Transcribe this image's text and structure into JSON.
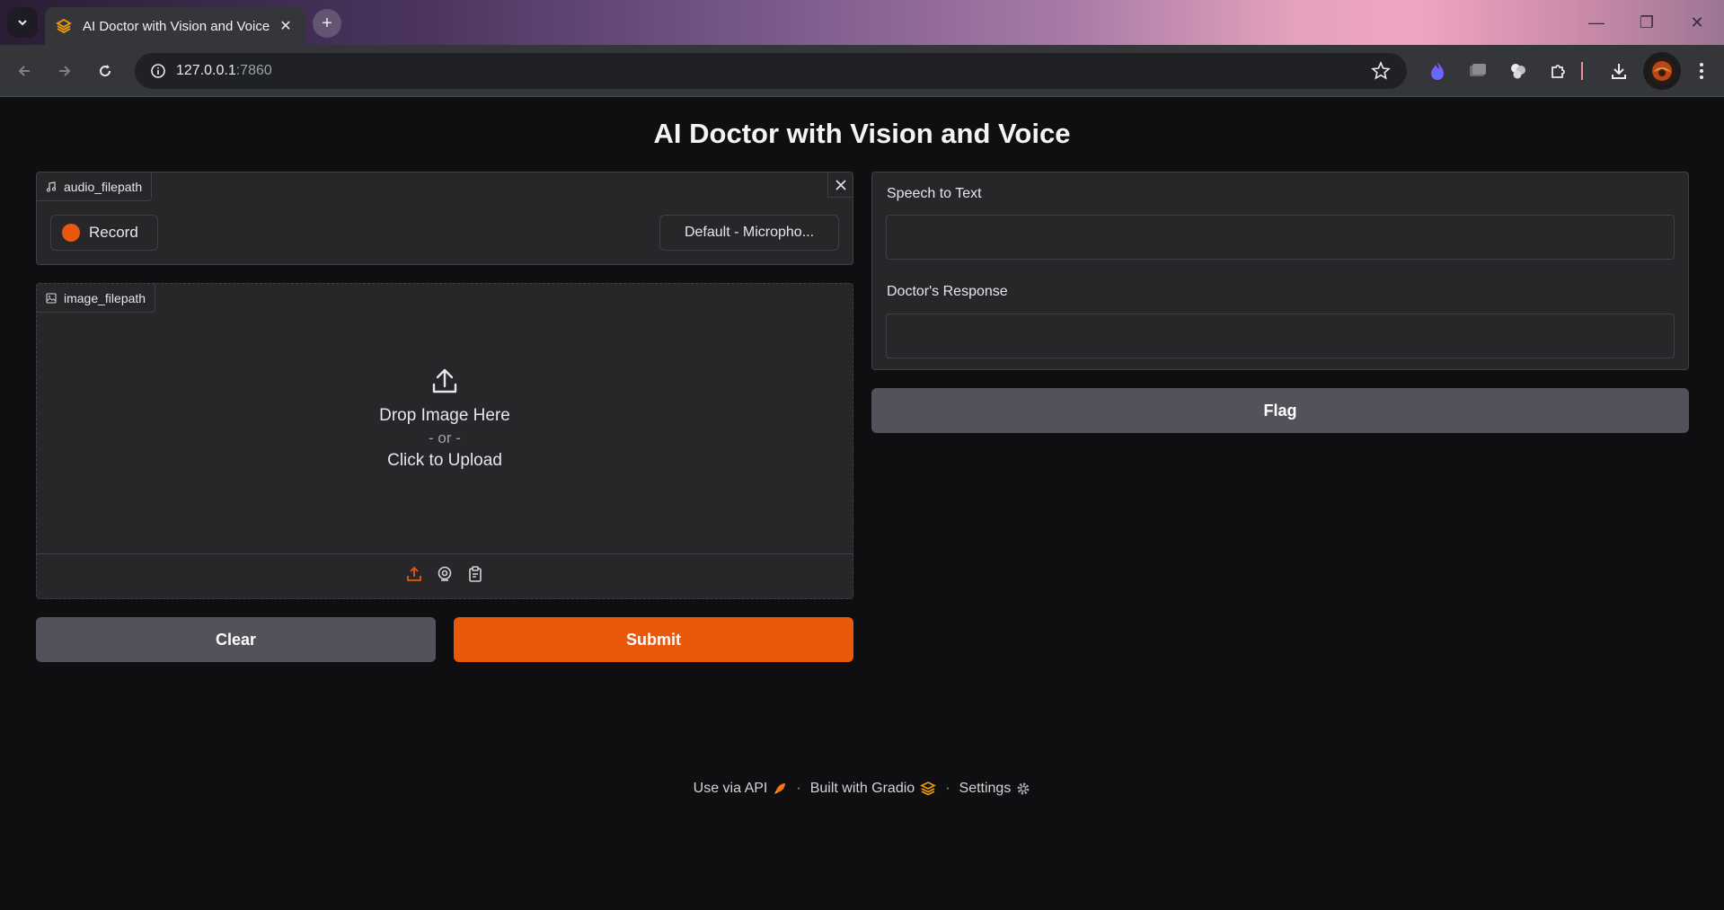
{
  "browser": {
    "tab_title": "AI Doctor with Vision and Voice",
    "url_host": "127.0.0.1",
    "url_port": ":7860"
  },
  "app": {
    "title": "AI Doctor with Vision and Voice",
    "audio": {
      "label": "audio_filepath",
      "record_label": "Record",
      "device_label": "Default - Micropho..."
    },
    "image": {
      "label": "image_filepath",
      "drop_text": "Drop Image Here",
      "or_text": "- or -",
      "click_text": "Click to Upload"
    },
    "buttons": {
      "clear": "Clear",
      "submit": "Submit",
      "flag": "Flag"
    },
    "outputs": {
      "speech_label": "Speech to Text",
      "speech_value": "",
      "response_label": "Doctor's Response",
      "response_value": ""
    },
    "footer": {
      "api": "Use via API",
      "built": "Built with Gradio",
      "settings": "Settings"
    }
  },
  "colors": {
    "accent": "#ea580c",
    "background": "#0f0f11",
    "panel": "#27272a"
  }
}
